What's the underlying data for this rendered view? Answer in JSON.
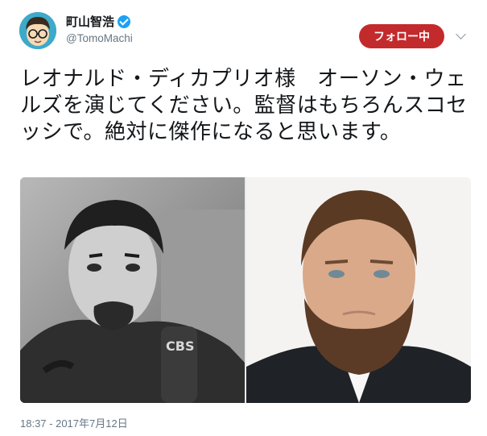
{
  "author": {
    "display_name": "町山智浩",
    "handle": "@TomoMachi",
    "verified": true
  },
  "follow_button_label": "フォロー中",
  "tweet": {
    "text": "レオナルド・ディカプリオ様　オーソン・ウェルズを演じてください。監督はもちろんスコセッシで。絶対に傑作になると思います。",
    "timestamp": "18:37 - 2017年7月12日"
  },
  "media": {
    "left_photo_text": "CBS"
  },
  "colors": {
    "follow_button": "#c32a2c",
    "verified_badge": "#1da1f2",
    "secondary_text": "#657786"
  },
  "icons": [
    "verified-badge-icon",
    "chevron-down-icon"
  ]
}
